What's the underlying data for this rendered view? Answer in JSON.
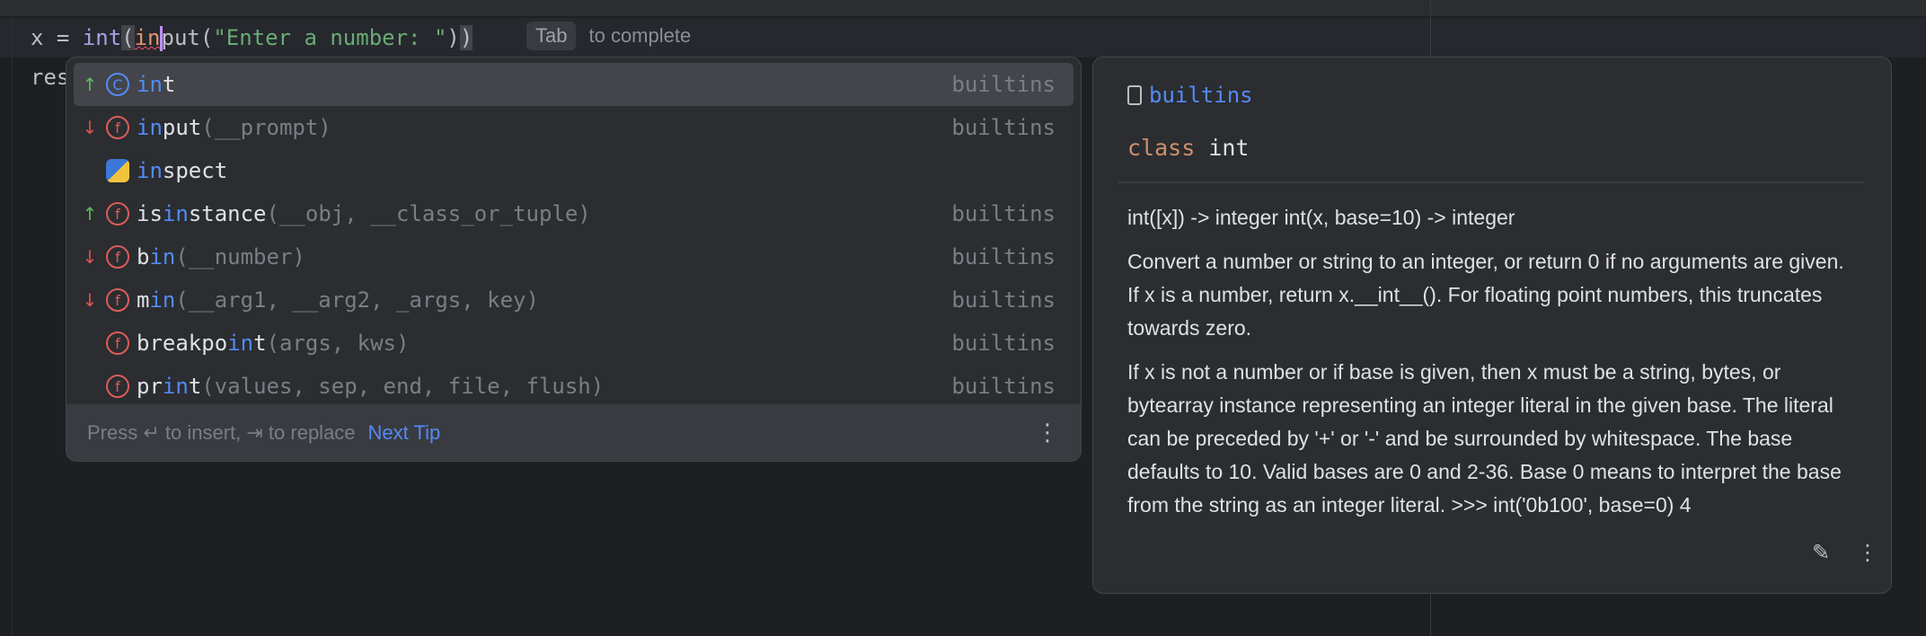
{
  "editor": {
    "line1": {
      "var": "x = ",
      "fn": "int",
      "open": "(",
      "typed": "in",
      "rest": "put(",
      "str": "\"Enter a number: \"",
      "close1": ")",
      "close2": ")"
    },
    "line2": "res"
  },
  "inline_hint": {
    "key": "Tab",
    "text": "to complete"
  },
  "completion": {
    "items": [
      {
        "arrow": "up",
        "icon": "class",
        "pre": "",
        "match": "in",
        "post": "t",
        "params": "",
        "source": "builtins"
      },
      {
        "arrow": "down",
        "icon": "function",
        "pre": "",
        "match": "in",
        "post": "put",
        "params": "(__prompt)",
        "source": "builtins"
      },
      {
        "arrow": "",
        "icon": "python",
        "pre": "",
        "match": "in",
        "post": "spect",
        "params": "",
        "source": ""
      },
      {
        "arrow": "up",
        "icon": "function",
        "pre": "is",
        "match": "in",
        "post": "stance",
        "params": "(__obj, __class_or_tuple)",
        "source": "builtins"
      },
      {
        "arrow": "down",
        "icon": "function",
        "pre": "b",
        "match": "in",
        "post": "",
        "params": "(__number)",
        "source": "builtins"
      },
      {
        "arrow": "down",
        "icon": "function",
        "pre": "m",
        "match": "in",
        "post": "",
        "params": "(__arg1, __arg2, _args, key)",
        "source": "builtins"
      },
      {
        "arrow": "",
        "icon": "function",
        "pre": "breakpo",
        "match": "in",
        "post": "t",
        "params": "(args, kws)",
        "source": "builtins"
      },
      {
        "arrow": "",
        "icon": "function",
        "pre": "pr",
        "match": "in",
        "post": "t",
        "params": "(values, sep, end, file, flush)",
        "source": "builtins"
      }
    ],
    "footer": {
      "hint": "Press ↵ to insert, ⇥ to replace",
      "next_tip": "Next Tip"
    }
  },
  "doc": {
    "module": "builtins",
    "keyword": "class",
    "name": "int",
    "paragraphs": [
      "int([x]) -> integer int(x, base=10) -> integer",
      "Convert a number or string to an integer, or return 0 if no arguments are given. If x is a number, return x.__int__(). For floating point numbers, this truncates towards zero.",
      "If x is not a number or if base is given, then x must be a string, bytes, or bytearray instance representing an integer literal in the given base. The literal can be preceded by '+' or '-' and be surrounded by whitespace. The base defaults to 10. Valid bases are 0 and 2-36. Base 0 means to interpret the base from the string as an integer literal. >>> int('0b100', base=0) 4"
    ]
  }
}
